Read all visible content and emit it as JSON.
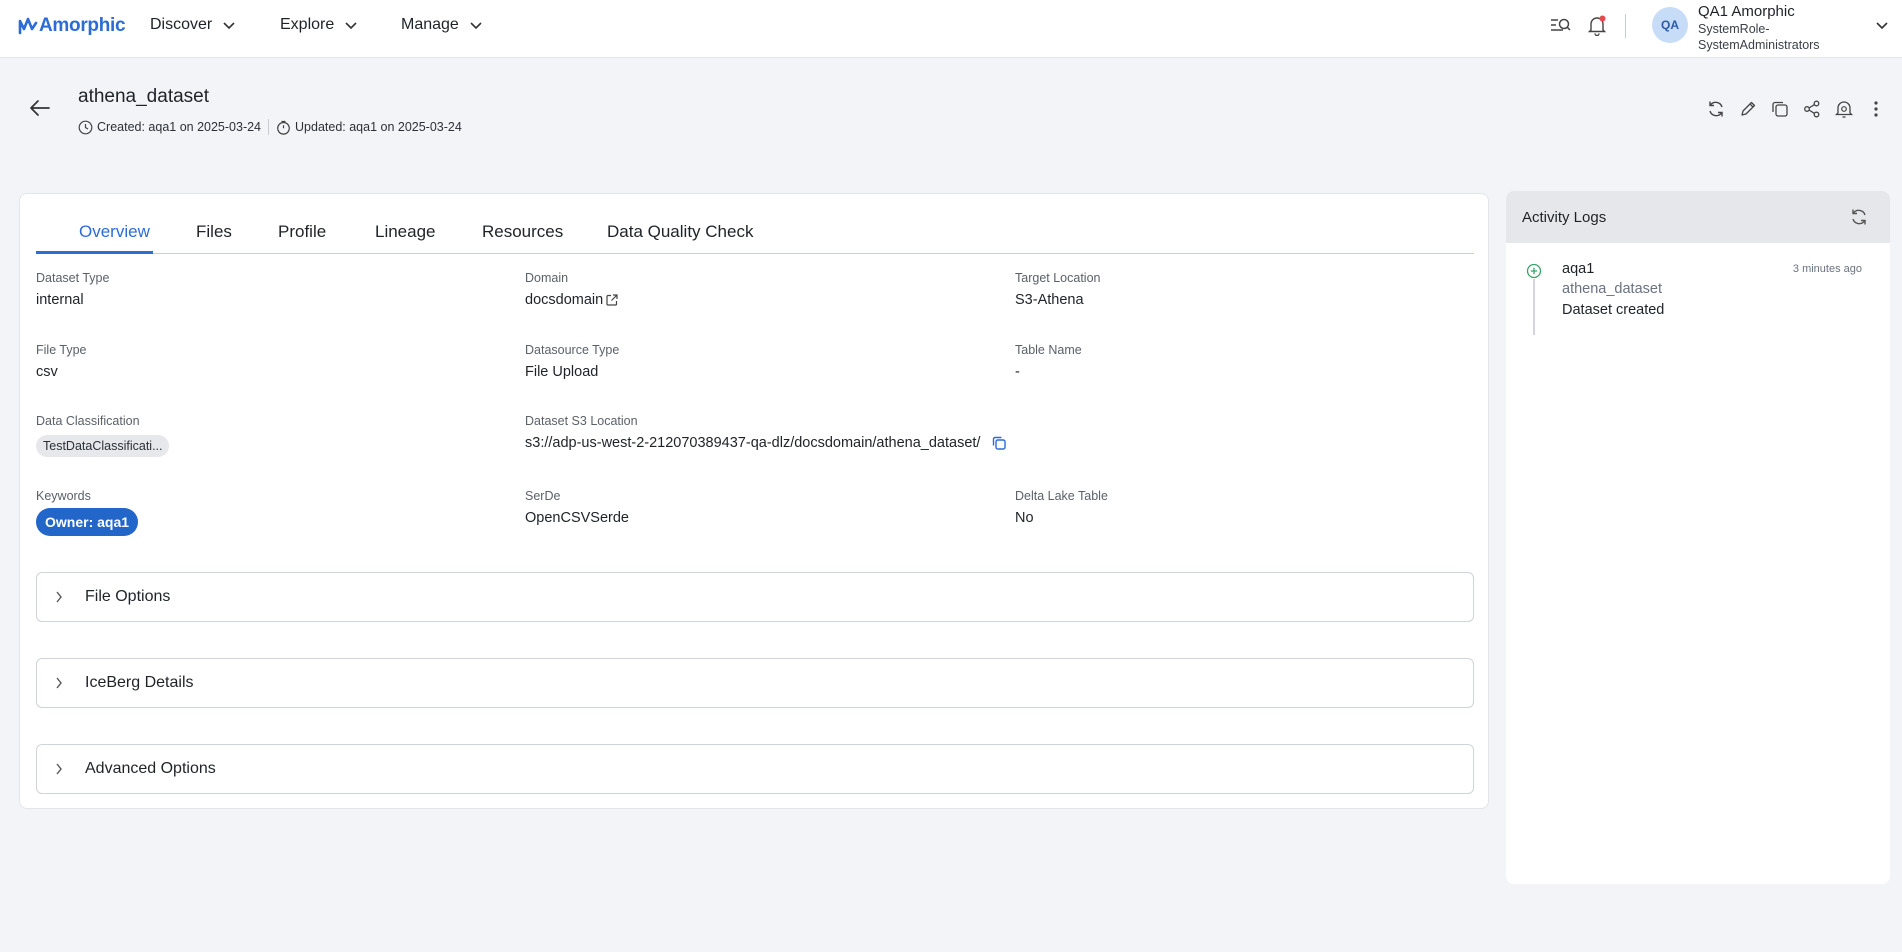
{
  "brand": {
    "name": "Amorphic"
  },
  "nav": {
    "items": [
      {
        "label": "Discover"
      },
      {
        "label": "Explore"
      },
      {
        "label": "Manage"
      }
    ]
  },
  "user": {
    "initials": "QA",
    "name": "QA1 Amorphic",
    "role": "SystemRole-SystemAdministrators"
  },
  "header": {
    "title": "athena_dataset",
    "created": "Created: aqa1 on 2025-03-24",
    "updated": "Updated: aqa1 on 2025-03-24"
  },
  "tabs": [
    {
      "label": "Overview"
    },
    {
      "label": "Files"
    },
    {
      "label": "Profile"
    },
    {
      "label": "Lineage"
    },
    {
      "label": "Resources"
    },
    {
      "label": "Data Quality Check"
    }
  ],
  "fields": {
    "dataset_type": {
      "label": "Dataset Type",
      "value": "internal"
    },
    "domain": {
      "label": "Domain",
      "value": "docsdomain"
    },
    "target_location": {
      "label": "Target Location",
      "value": "S3-Athena"
    },
    "file_type": {
      "label": "File Type",
      "value": "csv"
    },
    "datasource_type": {
      "label": "Datasource Type",
      "value": "File Upload"
    },
    "table_name": {
      "label": "Table Name",
      "value": "-"
    },
    "data_classification": {
      "label": "Data Classification",
      "value": "TestDataClassificati..."
    },
    "s3_location": {
      "label": "Dataset S3 Location",
      "value": "s3://adp-us-west-2-212070389437-qa-dlz/docsdomain/athena_dataset/"
    },
    "keywords": {
      "label": "Keywords",
      "value": "Owner: aqa1"
    },
    "serde": {
      "label": "SerDe",
      "value": "OpenCSVSerde"
    },
    "delta_lake": {
      "label": "Delta Lake Table",
      "value": "No"
    }
  },
  "sections": [
    {
      "label": "File Options"
    },
    {
      "label": "IceBerg Details"
    },
    {
      "label": "Advanced Options"
    }
  ],
  "activity": {
    "title": "Activity Logs",
    "entries": [
      {
        "user": "aqa1",
        "dataset": "athena_dataset",
        "message": "Dataset created",
        "time": "3 minutes ago"
      }
    ]
  },
  "colors": {
    "accent": "#2d6bd6",
    "keyword_bg": "#2266c9",
    "activity_add": "#3aa36a"
  }
}
